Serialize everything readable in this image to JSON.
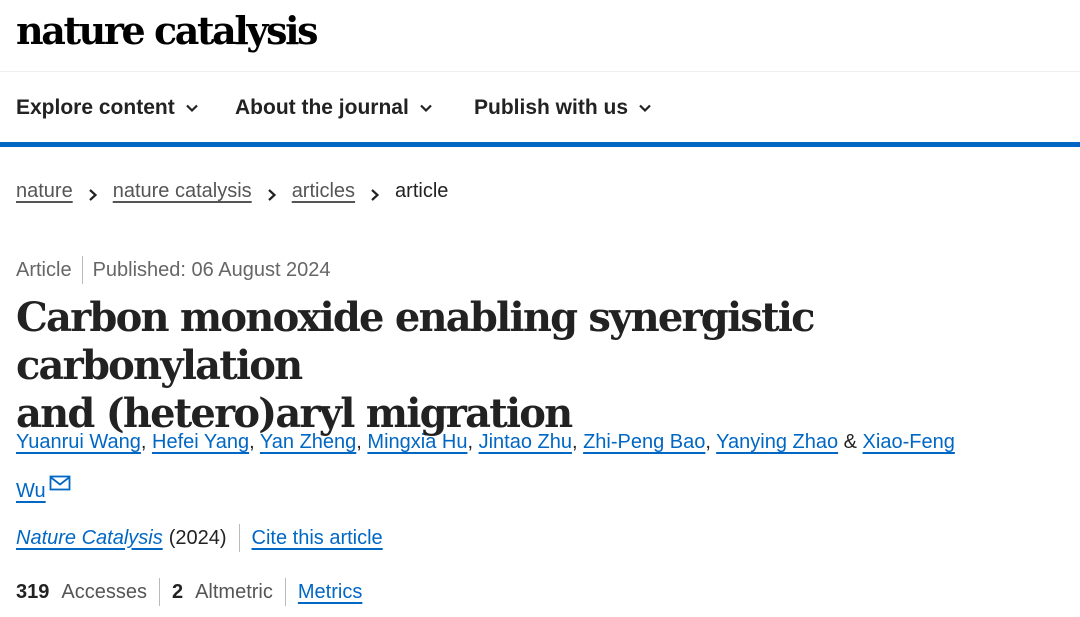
{
  "brand": {
    "logo_text": "nature catalysis"
  },
  "nav": {
    "items": [
      {
        "label": "Explore content",
        "icon": "chevron-down-icon"
      },
      {
        "label": "About the journal",
        "icon": "chevron-down-icon"
      },
      {
        "label": "Publish with us",
        "icon": "chevron-down-icon"
      }
    ],
    "accent_color": "#0067c5"
  },
  "breadcrumb": {
    "items": [
      "nature",
      "nature catalysis",
      "articles"
    ],
    "current": "article",
    "separator_icon": "chevron-right-icon"
  },
  "article": {
    "type": "Article",
    "published": "Published: 06 August 2024",
    "title_line1": "Carbon monoxide enabling synergistic carbonylation",
    "title_line2": "and (hetero)aryl migration",
    "authors": [
      "Yuanrui Wang",
      "Hefei Yang",
      "Yan Zheng",
      "Mingxia Hu",
      "Jintao Zhu",
      "Zhi-Peng Bao",
      "Yanying Zhao"
    ],
    "author_separator": ", ",
    "author_conjunction": " & ",
    "last_author_part1": "Xiao-Feng",
    "last_author_part2": "Wu",
    "contact_icon": "envelope-icon",
    "journal": "Nature Catalysis",
    "year": "(2024)",
    "cite_label": "Cite this article",
    "accesses_count": "319",
    "accesses_label": "Accesses",
    "altmetric_score": "2",
    "altmetric_label": "Altmetric",
    "metrics_label": "Metrics"
  },
  "colors": {
    "link": "#0067c5",
    "text": "#222222",
    "muted": "#666666"
  }
}
